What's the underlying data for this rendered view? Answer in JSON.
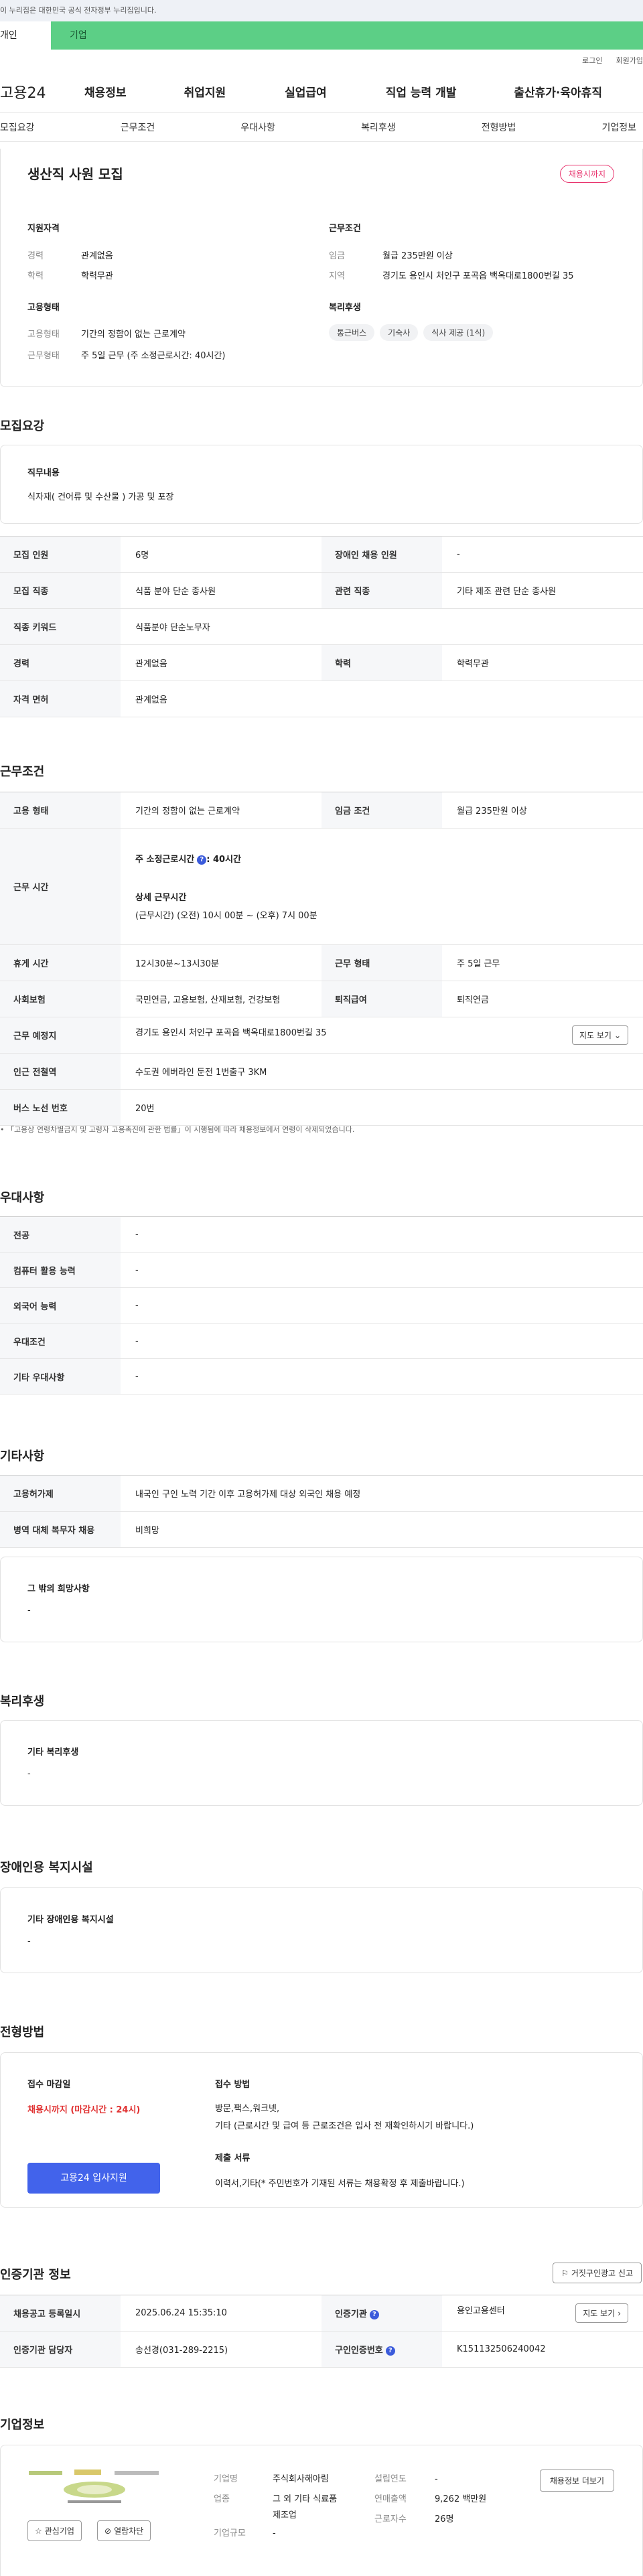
{
  "gov_banner": "이 누리집은 대한민국 공식 전자정부 누리집입니다.",
  "topbar": {
    "left": "개인",
    "right": "기업"
  },
  "util": {
    "login": "로그인",
    "signup": "회원가입"
  },
  "nav": {
    "logo": "고용24",
    "menu": [
      "채용정보",
      "취업지원",
      "실업급여",
      "직업 능력 개발",
      "출산휴가·육아휴직"
    ]
  },
  "tabs": [
    "모집요강",
    "근무조건",
    "우대사항",
    "복리후생",
    "전형방법",
    "기업정보"
  ],
  "summary": {
    "title": "생산직 사원 모집",
    "badge": "채용시까지",
    "qual": {
      "h": "지원자격",
      "rows": [
        {
          "k": "경력",
          "v": "관계없음"
        },
        {
          "k": "학력",
          "v": "학력무관"
        }
      ]
    },
    "cond": {
      "h": "근무조건",
      "rows": [
        {
          "k": "임금",
          "v": "월급 235만원 이상"
        },
        {
          "k": "지역",
          "v": "경기도 용인시 처인구 포곡읍 백옥대로1800번길 35"
        }
      ]
    },
    "emp": {
      "h": "고용형태",
      "rows": [
        {
          "k": "고용형태",
          "v": "기간의 정함이 없는 근로계약"
        },
        {
          "k": "근무형태",
          "v": "주 5일 근무 (주 소정근로시간: 40시간)"
        }
      ]
    },
    "welfare": {
      "h": "복리후생",
      "chips": [
        "통근버스",
        "기숙사",
        "식사 제공 (1식)"
      ]
    }
  },
  "recruit": {
    "h": "모집요강",
    "duty_h": "직무내용",
    "duty": "식자재( 건어류 및 수산물 ) 가공 및 포장",
    "rows": [
      {
        "k1": "모집 인원",
        "v1": "6명",
        "k2": "장애인 채용 인원",
        "v2": "-"
      },
      {
        "k1": "모집 직종",
        "v1": "식품 분야 단순 종사원",
        "k2": "관련 직종",
        "v2": "기타 제조 관련 단순 종사원"
      },
      {
        "k1": "직종 키워드",
        "v1": "식품분야 단순노무자"
      },
      {
        "k1": "경력",
        "v1": "관계없음",
        "k2": "학력",
        "v2": "학력무관"
      },
      {
        "k1": "자격 면허",
        "v1": "관계없음"
      }
    ]
  },
  "work": {
    "h": "근무조건",
    "r1": {
      "k1": "고용 형태",
      "v1": "기간의 정함이 없는 근로계약",
      "k2": "임금 조건",
      "v2": "월급 235만원 이상"
    },
    "hours": {
      "k": "근무 시간",
      "l1": "주 소정근로시간",
      "l1b": ": 40시간",
      "l2": "상세 근무시간",
      "l3": "(근무시간) (오전) 10시 00분 ~ (오후) 7시 00분"
    },
    "r3": {
      "k1": "휴게 시간",
      "v1": "12시30분~13시30분",
      "k2": "근무 형태",
      "v2": "주 5일 근무"
    },
    "r4": {
      "k1": "사회보험",
      "v1": "국민연금, 고용보험, 산재보험, 건강보험",
      "k2": "퇴직급여",
      "v2": "퇴직연금"
    },
    "r5": {
      "k": "근무 예정지",
      "v": "경기도 용인시 처인구 포곡읍 백옥대로1800번길 35",
      "btn": "지도 보기"
    },
    "r6": {
      "k": "인근 전철역",
      "v": "수도권 에버라인 둔전 1번출구 3KM"
    },
    "r7": {
      "k": "버스 노선 번호",
      "v": "20번"
    },
    "note": "「고용상 연령차별금지 및 고령자 고용촉진에 관한 법률」이 시행됨에 따라 채용정보에서 연령이 삭제되었습니다."
  },
  "pref": {
    "h": "우대사항",
    "rows": [
      {
        "k": "전공",
        "v": "-"
      },
      {
        "k": "컴퓨터 활용 능력",
        "v": "-"
      },
      {
        "k": "외국어 능력",
        "v": "-"
      },
      {
        "k": "우대조건",
        "v": "-"
      },
      {
        "k": "기타 우대사항",
        "v": "-"
      }
    ]
  },
  "etc": {
    "h": "기타사항",
    "rows": [
      {
        "k": "고용허가제",
        "v": "내국인 구인 노력 기간 이후 고용허가제 대상 외국인 채용 예정"
      },
      {
        "k": "병역 대체 복무자 채용",
        "v": "비희망"
      }
    ],
    "box_h": "그 밖의 희망사항",
    "box_v": "-"
  },
  "benefit": {
    "h": "복리후생",
    "box_h": "기타 복리후생",
    "box_v": "-"
  },
  "disab": {
    "h": "장애인용 복지시설",
    "box_h": "기타 장애인용 복지시설",
    "box_v": "-"
  },
  "selection": {
    "h": "전형방법",
    "deadline_h": "접수 마감일",
    "deadline": "채용시까지 (마감시간 : 24시)",
    "apply": "고용24 입사지원",
    "method_h": "접수 방법",
    "method1": "방문,팩스,워크넷,",
    "method2": "기타 (근로시간 및 급여 등 근로조건은 입사 전 재확인하시기 바랍니다.)",
    "docs_h": "제출 서류",
    "docs": "이력서,기타(* 주민번호가 기재된 서류는 채용확정 후 제출바랍니다.)"
  },
  "agency": {
    "h": "인증기관 정보",
    "report": "거짓구인광고 신고",
    "r1": {
      "k1": "채용공고 등록일시",
      "v1": "2025.06.24 15:35:10",
      "k2": "인증기관",
      "v2": "용인고용센터",
      "btn": "지도 보기"
    },
    "r2": {
      "k1": "인증기관 담당자",
      "v1": "송선경(031-289-2215)",
      "k2": "구인인증번호",
      "v2": "K151132506240042"
    }
  },
  "company": {
    "h": "기업정보",
    "interest": "관심기업",
    "hide": "열람차단",
    "more": "채용정보 더보기",
    "name_k": "기업명",
    "name_v": "주식회사해아림",
    "ind_k": "업종",
    "ind_v": "그 외 기타 식료품 제조업",
    "size_k": "기업규모",
    "size_v": "-",
    "year_k": "설립연도",
    "year_v": "-",
    "sales_k": "연매출액",
    "sales_v": "9,262 백만원",
    "emp_k": "근로자수",
    "emp_v": "26명"
  },
  "colors": {
    "green": "#5ccf86",
    "red": "#e03131",
    "blue": "#4263eb",
    "pink": "#e8336d"
  }
}
